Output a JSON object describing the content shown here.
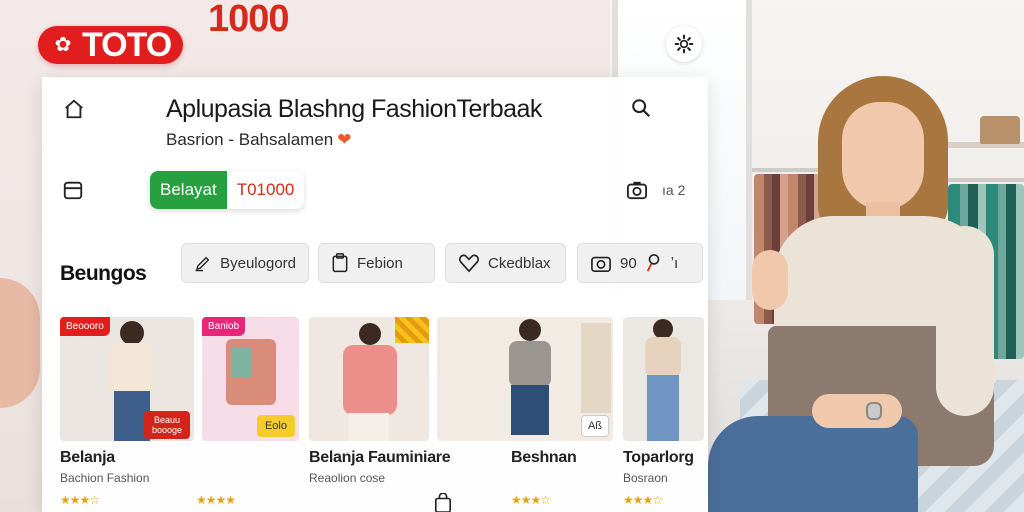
{
  "brand": {
    "logo_text": "TOTO",
    "logo_number": "1000",
    "logo_color": "#e11d1d"
  },
  "header": {
    "title": "Aplupasia Blashng FashionTerbaak",
    "subtitle": "Basrion - Bahsalamen",
    "subtitle_emoji": "❤",
    "home_icon": "home-icon",
    "search_icon": "search-icon",
    "settings_icon": "gear-icon"
  },
  "cta": {
    "primary_label": "Belayat",
    "secondary_label": "T0\u00001000"
  },
  "toolbar": {
    "camera_count": "ıa 2"
  },
  "categories": {
    "heading": "Beungos",
    "chips": [
      {
        "label": "Byeulogord",
        "icon": "pen-icon"
      },
      {
        "label": "Febion",
        "icon": "clipboard-icon"
      },
      {
        "label": "Ckedblax",
        "icon": "heart-icon"
      },
      {
        "label": "90",
        "icon": "camera-icon",
        "extra": "ʼı"
      }
    ]
  },
  "products": [
    {
      "name": "Belanja",
      "desc": "Bachion Fashion",
      "stars": "★★★☆",
      "badge": "Beoooro",
      "tag": "Beauu boooge"
    },
    {
      "name": "",
      "desc": "",
      "stars": "★★★★",
      "badge": "Baniob",
      "tag": "Eolo"
    },
    {
      "name": "Belanja Fauminiare",
      "desc": "Reaolion cose",
      "stars": "★★★☆",
      "badge": "",
      "tag": ""
    },
    {
      "name": "",
      "desc": "",
      "stars": "★★★☆",
      "badge": "",
      "tag": "Aß"
    },
    {
      "name": "Beshnan",
      "desc": "",
      "stars": "",
      "badge": "",
      "tag": ""
    },
    {
      "name": "Toparlorg",
      "desc": "Bosraon",
      "stars": "★★★☆",
      "badge": "",
      "tag": ""
    }
  ],
  "colors": {
    "accent_green": "#27a040",
    "accent_red": "#d62a1a",
    "star": "#e3a21a"
  }
}
